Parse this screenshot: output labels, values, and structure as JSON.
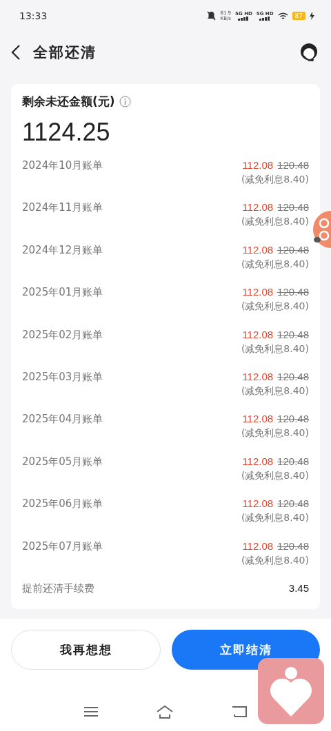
{
  "status_bar": {
    "time": "13:33",
    "net_speed": "61.9",
    "net_unit": "KB/s",
    "signals": [
      "5G HD",
      "5G HD"
    ],
    "battery": "87"
  },
  "header": {
    "title": "全部还清"
  },
  "summary": {
    "label": "剩余未还金额(元)",
    "amount": "1124.25"
  },
  "bills": [
    {
      "month": "2024年10月账单",
      "amount": "112.08",
      "original": "120.48",
      "note": "(减免利息8.40)"
    },
    {
      "month": "2024年11月账单",
      "amount": "112.08",
      "original": "120.48",
      "note": "(减免利息8.40)"
    },
    {
      "month": "2024年12月账单",
      "amount": "112.08",
      "original": "120.48",
      "note": "(减免利息8.40)"
    },
    {
      "month": "2025年01月账单",
      "amount": "112.08",
      "original": "120.48",
      "note": "(减免利息8.40)"
    },
    {
      "month": "2025年02月账单",
      "amount": "112.08",
      "original": "120.48",
      "note": "(减免利息8.40)"
    },
    {
      "month": "2025年03月账单",
      "amount": "112.08",
      "original": "120.48",
      "note": "(减免利息8.40)"
    },
    {
      "month": "2025年04月账单",
      "amount": "112.08",
      "original": "120.48",
      "note": "(减免利息8.40)"
    },
    {
      "month": "2025年05月账单",
      "amount": "112.08",
      "original": "120.48",
      "note": "(减免利息8.40)"
    },
    {
      "month": "2025年06月账单",
      "amount": "112.08",
      "original": "120.48",
      "note": "(减免利息8.40)"
    },
    {
      "month": "2025年07月账单",
      "amount": "112.08",
      "original": "120.48",
      "note": "(减免利息8.40)"
    }
  ],
  "fee": {
    "label": "提前还清手续费",
    "value": "3.45"
  },
  "buttons": [
    {
      "label": "我再想想",
      "kind": "secondary"
    },
    {
      "label": "立即结清",
      "kind": "primary"
    }
  ]
}
